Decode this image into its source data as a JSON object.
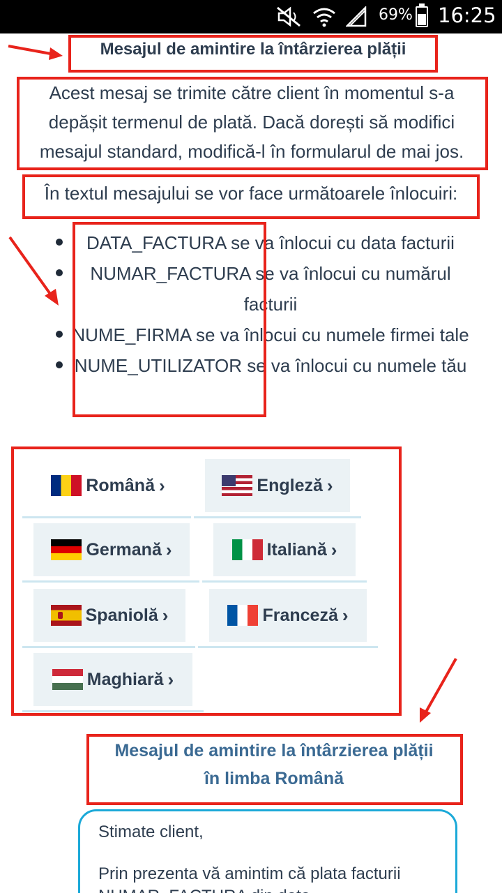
{
  "status_bar": {
    "battery": "69%",
    "time": "16:25"
  },
  "page": {
    "title": "Mesajul de amintire la întârzierea plății",
    "description": "Acest mesaj se trimite către client în momentul s-a depășit termenul de plată. Dacă dorești să modifici mesajul standard, modifică-l în formularul de mai jos.",
    "replacements_intro": "În textul mesajului se vor face următoarele înlocuiri:",
    "replacements": [
      "DATA_FACTURA se va înlocui cu data facturii",
      "NUMAR_FACTURA se va înlocui cu numărul facturii",
      "NUME_FIRMA se va înlocui cu numele firmei tale",
      "NUME_UTILIZATOR se va înlocui cu numele tău"
    ]
  },
  "languages": [
    {
      "label": "Română",
      "flag": "ro"
    },
    {
      "label": "Engleză",
      "flag": "us"
    },
    {
      "label": "Germană",
      "flag": "de"
    },
    {
      "label": "Italiană",
      "flag": "it"
    },
    {
      "label": "Spaniolă",
      "flag": "es"
    },
    {
      "label": "Franceză",
      "flag": "fr"
    },
    {
      "label": "Maghiară",
      "flag": "hu"
    }
  ],
  "message_section": {
    "heading_line1": "Mesajul de amintire la întârzierea plății",
    "heading_line2": "în limba Română",
    "greeting": "Stimate client,",
    "body": "Prin prezenta vă amintim că plata facturii NUMAR_FACTURA din data DATA_FACTURA"
  },
  "colors": {
    "annotation_red": "#e8231b",
    "accent_blue": "#1ba9d8",
    "heading_blue": "#3b6a93"
  }
}
